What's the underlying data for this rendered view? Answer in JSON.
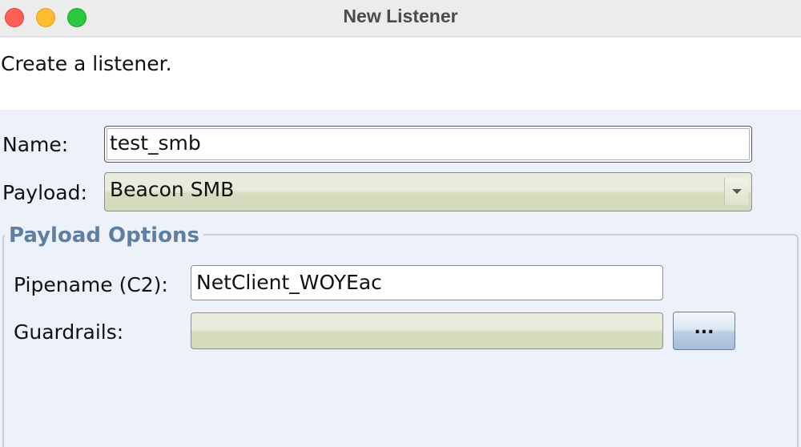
{
  "window": {
    "title": "New Listener"
  },
  "description": "Create a listener.",
  "form": {
    "name_label": "Name:",
    "name_value": "test_smb",
    "payload_label": "Payload:",
    "payload_value": "Beacon SMB"
  },
  "payload_options": {
    "title": "Payload Options",
    "pipename_label": "Pipename (C2):",
    "pipename_value": "NetClient_WOYEac",
    "guardrails_label": "Guardrails:",
    "guardrails_value": "",
    "guardrails_button_label": "..."
  },
  "colors": {
    "close": "#fe5f57",
    "minimize": "#febc2e",
    "maximize": "#28c840",
    "group_title": "#5e7ea2"
  }
}
